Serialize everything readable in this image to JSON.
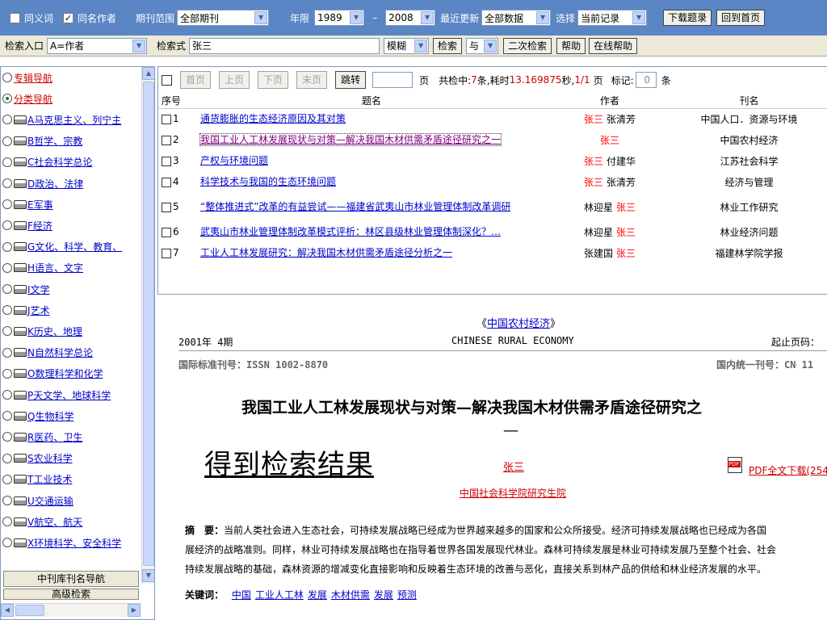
{
  "topbar": {
    "synonym_label": "同义词",
    "same_author_label": "同名作者",
    "journal_range_label": "期刊范围",
    "journal_range_value": "全部期刊",
    "year_label": "年限",
    "year_from": "1989",
    "year_sep": "–",
    "year_to": "2008",
    "update_label": "最近更新",
    "update_value": "全部数据",
    "select_label": "选择",
    "select_value": "当前记录",
    "download_button": "下载题录",
    "home_button": "回到首页"
  },
  "searchbar": {
    "entry_label": "检索入口",
    "entry_value": "A=作者",
    "expr_label": "检索式",
    "expr_value": "张三",
    "match_value": "模糊",
    "search_button": "检索",
    "logic_value": "与",
    "secondary_button": "二次检索",
    "help_button": "帮助",
    "online_help_button": "在线帮助"
  },
  "tree": {
    "items": [
      {
        "label": "专辑导航",
        "radio": true,
        "folder": false,
        "red": true,
        "selected": false
      },
      {
        "label": "分类导航",
        "radio": true,
        "folder": false,
        "red": true,
        "selected": true
      },
      {
        "label": "A马克思主义、列宁主",
        "radio": true,
        "folder": true,
        "red": false,
        "selected": false
      },
      {
        "label": "B哲学、宗教",
        "radio": true,
        "folder": true,
        "red": false,
        "selected": false
      },
      {
        "label": "C社会科学总论",
        "radio": true,
        "folder": true,
        "red": false,
        "selected": false
      },
      {
        "label": "D政治、法律",
        "radio": true,
        "folder": true,
        "red": false,
        "selected": false
      },
      {
        "label": "E军事",
        "radio": true,
        "folder": true,
        "red": false,
        "selected": false
      },
      {
        "label": "F经济",
        "radio": true,
        "folder": true,
        "red": false,
        "selected": false
      },
      {
        "label": "G文化、科学、教育、",
        "radio": true,
        "folder": true,
        "red": false,
        "selected": false
      },
      {
        "label": "H语言、文字",
        "radio": true,
        "folder": true,
        "red": false,
        "selected": false
      },
      {
        "label": "I文学",
        "radio": true,
        "folder": true,
        "red": false,
        "selected": false
      },
      {
        "label": "J艺术",
        "radio": true,
        "folder": true,
        "red": false,
        "selected": false
      },
      {
        "label": "K历史、地理",
        "radio": true,
        "folder": true,
        "red": false,
        "selected": false
      },
      {
        "label": "N自然科学总论",
        "radio": true,
        "folder": true,
        "red": false,
        "selected": false
      },
      {
        "label": "O数理科学和化学",
        "radio": true,
        "folder": true,
        "red": false,
        "selected": false
      },
      {
        "label": "P天文学、地球科学",
        "radio": true,
        "folder": true,
        "red": false,
        "selected": false
      },
      {
        "label": "Q生物科学",
        "radio": true,
        "folder": true,
        "red": false,
        "selected": false
      },
      {
        "label": "R医药、卫生",
        "radio": true,
        "folder": true,
        "red": false,
        "selected": false
      },
      {
        "label": "S农业科学",
        "radio": true,
        "folder": true,
        "red": false,
        "selected": false
      },
      {
        "label": "T工业技术",
        "radio": true,
        "folder": true,
        "red": false,
        "selected": false
      },
      {
        "label": "U交通运输",
        "radio": true,
        "folder": true,
        "red": false,
        "selected": false
      },
      {
        "label": "V航空、航天",
        "radio": true,
        "folder": true,
        "red": false,
        "selected": false
      },
      {
        "label": "X环境科学、安全科学",
        "radio": true,
        "folder": true,
        "red": false,
        "selected": false
      }
    ],
    "journal_nav_button": "中刊库刊名导航",
    "advanced_button": "高级检索"
  },
  "pager": {
    "first": "首页",
    "prev": "上页",
    "next": "下页",
    "last": "末页",
    "jump": "跳转",
    "jump_value": "",
    "page_unit": "页",
    "hits_prefix": "共检中:",
    "hits_count": "7",
    "hits_unit": "条,耗时",
    "time_value": "13.169875",
    "time_unit": "秒,",
    "page_info": "1/1",
    "page_suffix": "页",
    "mark_label": "标记:",
    "mark_value": "0",
    "mark_unit": "条"
  },
  "results": {
    "headers": {
      "no": "序号",
      "title": "题名",
      "author": "作者",
      "journal": "刊名"
    },
    "rows": [
      {
        "no": "1",
        "title": "通货膨胀的生态经济原因及其对策",
        "authors": [
          {
            "name": "张三",
            "hl": true
          },
          {
            "name": "张清芳",
            "hl": false
          }
        ],
        "journal": "中国人口．资源与环境",
        "visited": false
      },
      {
        "no": "2",
        "title": "我国工业人工林发展现状与对策—解决我国木材供需矛盾途径研究之一",
        "authors": [
          {
            "name": "张三",
            "hl": true
          }
        ],
        "journal": "中国农村经济",
        "visited": true
      },
      {
        "no": "3",
        "title": "产权与环境问题",
        "authors": [
          {
            "name": "张三",
            "hl": true
          },
          {
            "name": "付建华",
            "hl": false
          }
        ],
        "journal": "江苏社会科学",
        "visited": false
      },
      {
        "no": "4",
        "title": "科学技术与我国的生态环境问题",
        "authors": [
          {
            "name": "张三",
            "hl": true
          },
          {
            "name": "张清芳",
            "hl": false
          }
        ],
        "journal": "经济与管理",
        "visited": false
      },
      {
        "no": "5",
        "title": "“整体推进式”改革的有益尝试——福建省武夷山市林业管理体制改革调研",
        "authors": [
          {
            "name": "林迎星",
            "hl": false
          },
          {
            "name": "张三",
            "hl": true
          }
        ],
        "journal": "林业工作研究",
        "visited": false
      },
      {
        "no": "6",
        "title": "武夷山市林业管理体制改革模式评析：林区县级林业管理体制深化？…",
        "authors": [
          {
            "name": "林迎星",
            "hl": false
          },
          {
            "name": "张三",
            "hl": true
          }
        ],
        "journal": "林业经济问题",
        "visited": false
      },
      {
        "no": "7",
        "title": "工业人工林发展研究：解决我国木材供需矛盾途径分析之一",
        "authors": [
          {
            "name": "张建国",
            "hl": false
          },
          {
            "name": "张三",
            "hl": true
          }
        ],
        "journal": "福建林学院学报",
        "visited": false
      }
    ]
  },
  "detail": {
    "journal_link": "中国农村经济",
    "journal_open": "《",
    "journal_close": "》",
    "issue": "2001年 4期",
    "journal_en": "CHINESE RURAL ECONOMY",
    "page_range_label": "起止页码：",
    "issn": "国际标准刊号：ISSN 1002-8870",
    "cn": "国内统一刊号：CN 11",
    "article_title_line1": "我国工业人工林发展现状与对策—解决我国木材供需矛盾途径研究之",
    "article_title_line2": "—",
    "overlay_caption": "得到检索结果",
    "author_link": "张三",
    "pdf_link": "PDF全文下载(254",
    "institution_link": "中国社会科学院研究生院",
    "abstract_label": "摘　要：",
    "abstract_line1": "当前人类社会进入生态社会，可持续发展战略已经成为世界越来越多的国家和公众所接受。经济可持续发展战略也已经成为各国",
    "abstract_line2": "展经济的战略准则。同样，林业可持续发展战略也在指导着世界各国发展现代林业。森林可持续发展是林业可持续发展乃至整个社会、社会",
    "abstract_line3": "持续发展战略的基础，森林资源的增减变化直接影响和反映着生态环境的改善与恶化，直接关系到林产品的供给和林业经济发展的水平。",
    "keywords_label": "关键词：",
    "keywords": [
      "中国",
      "工业人工林",
      "发展",
      "木材供需",
      "发展",
      "预测"
    ]
  },
  "colors": {
    "topbar_bg": "#5a86c6",
    "toolbar_bg": "#ece9d8",
    "link": "#0000cc",
    "highlight": "#ff0000"
  }
}
